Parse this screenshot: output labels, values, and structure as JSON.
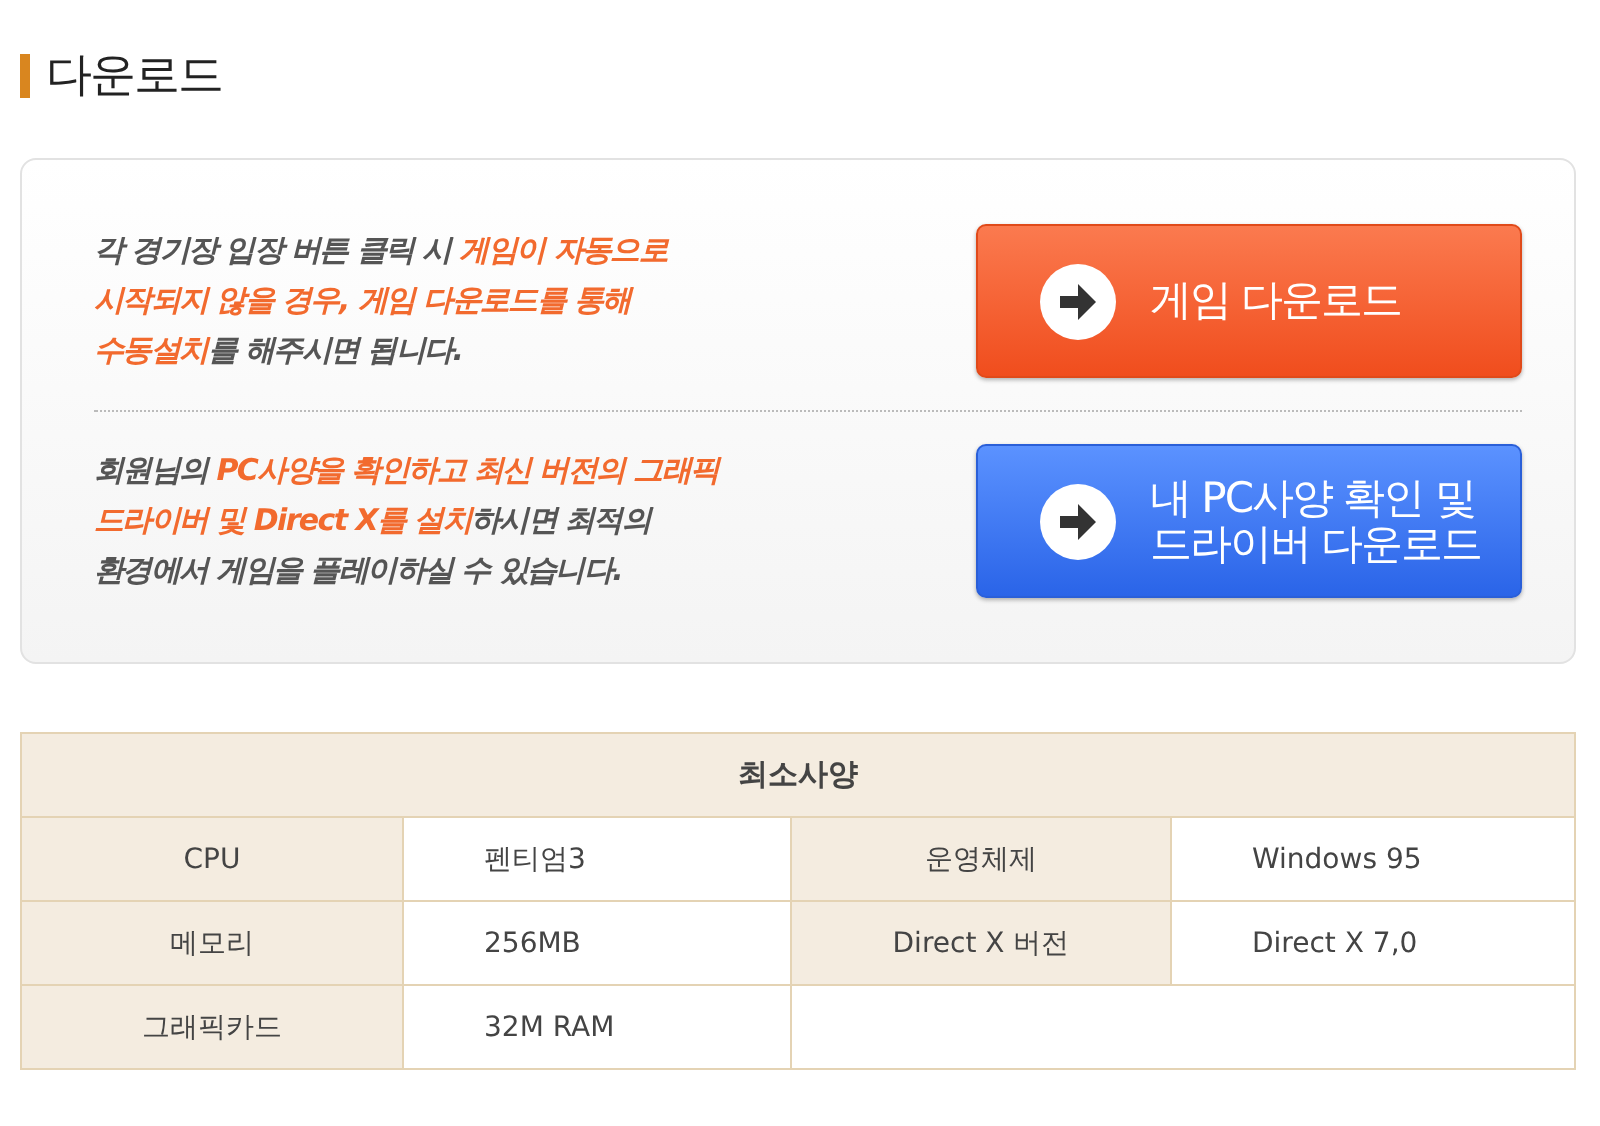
{
  "title": "다운로드",
  "sections": [
    {
      "lines": [
        [
          {
            "text": "각 경기장 입장 버튼 클릭 시 ",
            "highlight": false
          },
          {
            "text": "게임이 자동으로",
            "highlight": true
          }
        ],
        [
          {
            "text": "시작되지 않을 경우, 게임 다운로드를 통해",
            "highlight": true
          }
        ],
        [
          {
            "text": "수동설치",
            "highlight": true
          },
          {
            "text": "를 해주시면 됩니다.",
            "highlight": false
          }
        ]
      ],
      "button": {
        "lines": [
          "게임 다운로드"
        ],
        "kind": "orange"
      }
    },
    {
      "lines": [
        [
          {
            "text": "회원님의  ",
            "highlight": false
          },
          {
            "text": "PC사양을 확인하고 최신 버전의 그래픽",
            "highlight": true
          }
        ],
        [
          {
            "text": "드라이버 및 Direct X를 설치",
            "highlight": true
          },
          {
            "text": "하시면 최적의",
            "highlight": false
          }
        ],
        [
          {
            "text": "환경에서 게임을 플레이하실 수 있습니다.",
            "highlight": false
          }
        ]
      ],
      "button": {
        "lines": [
          "내 PC사양  확인 및",
          "드라이버 다운로드"
        ],
        "kind": "blue"
      }
    }
  ],
  "spec_table": {
    "title": "최소사양",
    "rows": [
      [
        "CPU",
        "펜티엄3",
        "운영체제",
        "Windows 95"
      ],
      [
        "메모리",
        "256MB",
        "Direct X 버전",
        "Direct X 7,0"
      ],
      [
        "그래픽카드",
        "32M RAM"
      ]
    ]
  }
}
